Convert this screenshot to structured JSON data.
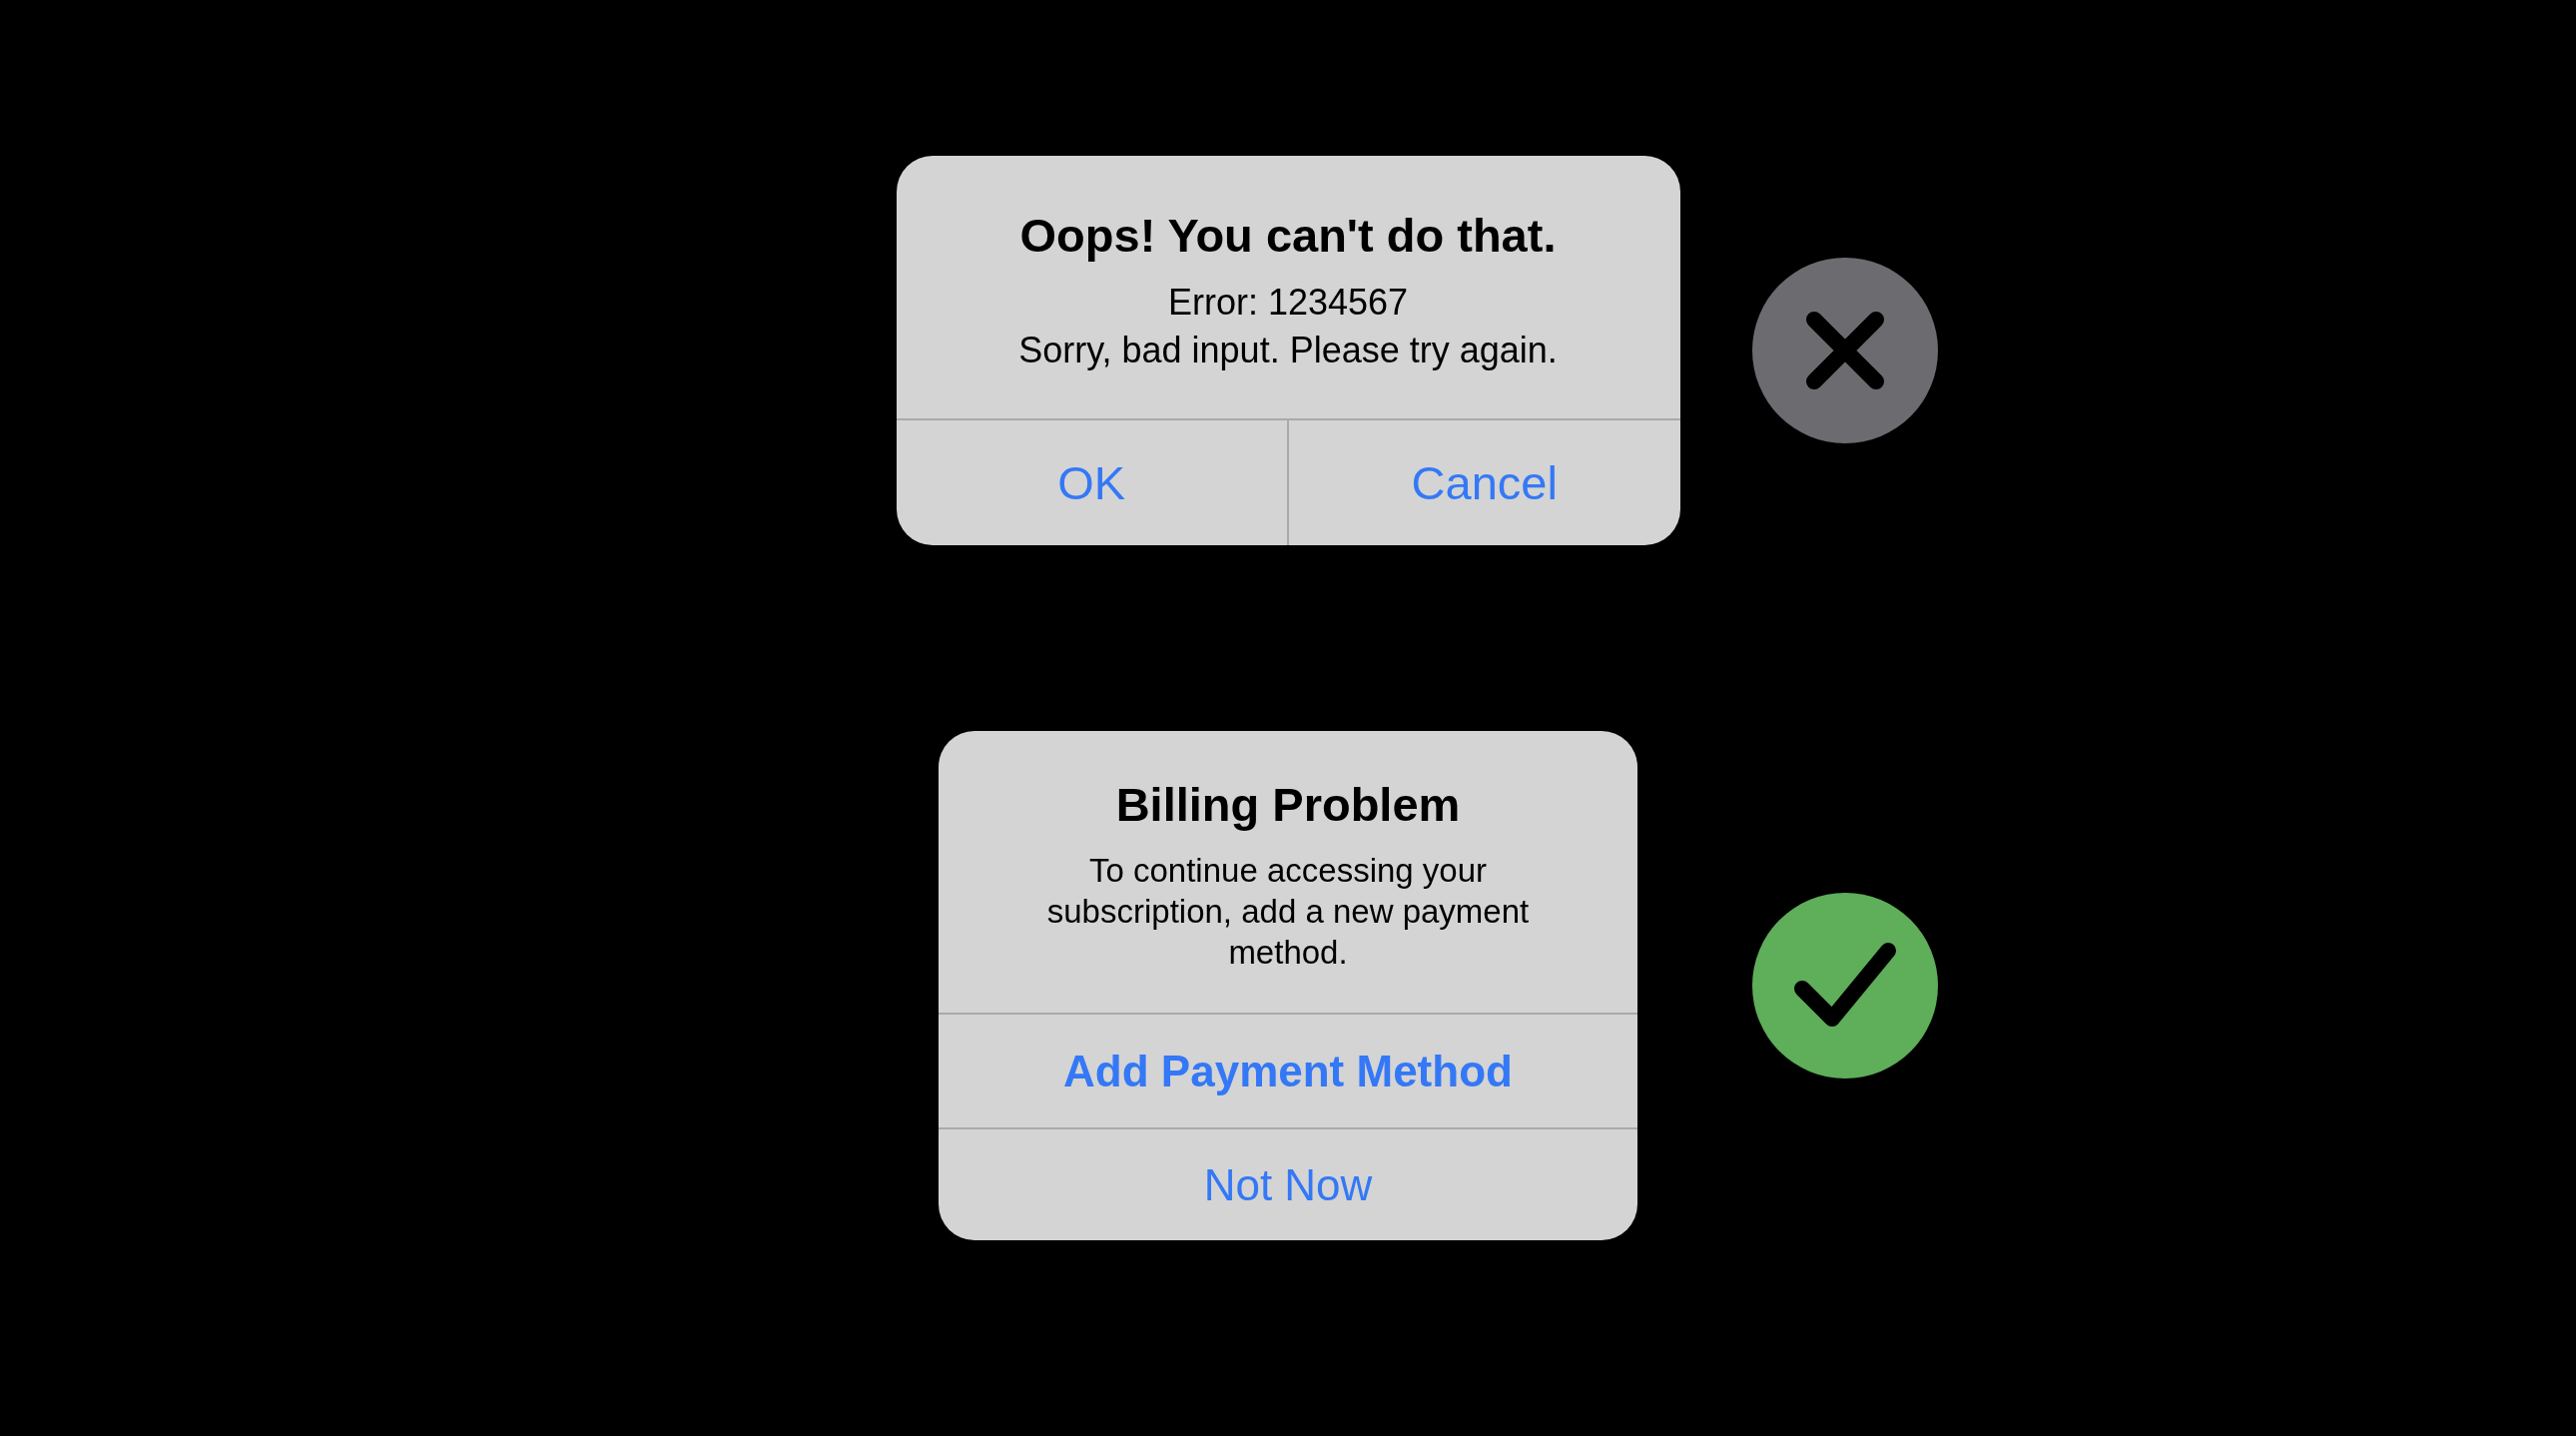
{
  "alerts": [
    {
      "title": "Oops! You can't do that.",
      "message": [
        "Error: 1234567",
        "Sorry, bad input. Please try again."
      ],
      "kind": "row",
      "buttons": [
        {
          "label": "OK",
          "bold": false
        },
        {
          "label": "Cancel",
          "bold": false
        }
      ],
      "verdict": {
        "kind": "cross"
      }
    },
    {
      "title": "Billing Problem",
      "message": [
        "To continue accessing your subscription, add a new payment method."
      ],
      "kind": "stack",
      "buttons": [
        {
          "label": "Add Payment Method",
          "bold": true
        },
        {
          "label": "Not Now",
          "bold": false
        }
      ],
      "verdict": {
        "kind": "check"
      }
    }
  ]
}
